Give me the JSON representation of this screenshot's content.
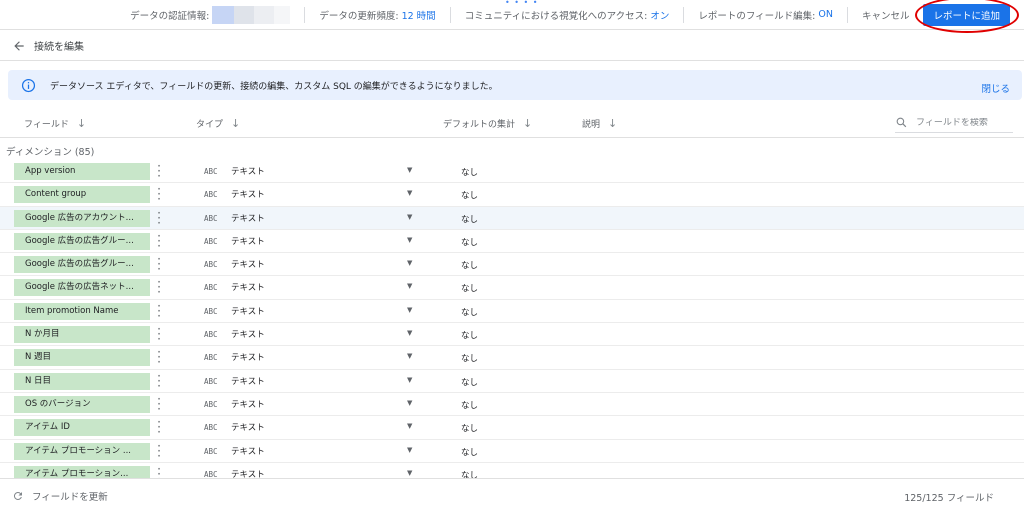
{
  "topbar": {
    "drag_handle": "• • • •",
    "credentials_label": "データの認証情報:",
    "freshness_label": "データの更新頻度:",
    "freshness_value": "12 時間",
    "community_label": "コミュニティにおける視覚化へのアクセス:",
    "community_value": "オン",
    "field_edit_label": "レポートのフィールド編集:",
    "field_edit_value": "ON",
    "cancel_label": "キャンセル",
    "add_to_report_label": "レポートに追加"
  },
  "backbar": {
    "label": "接続を編集"
  },
  "banner": {
    "message": "データソース エディタで、フィールドの更新、接続の編集、カスタム SQL の編集ができるようになりました。",
    "close_label": "閉じる"
  },
  "columns": {
    "field": "フィールド",
    "type": "タイプ",
    "default_agg": "デフォルトの集計",
    "description": "説明",
    "search_placeholder": "フィールドを検索"
  },
  "section_title": "ディメンション (85)",
  "rows": [
    {
      "name": "App version",
      "type_icon": "ABC",
      "type": "テキスト",
      "agg": "なし"
    },
    {
      "name": "Content group",
      "type_icon": "ABC",
      "type": "テキスト",
      "agg": "なし"
    },
    {
      "name": "Google 広告のアカウント...",
      "type_icon": "ABC",
      "type": "テキスト",
      "agg": "なし"
    },
    {
      "name": "Google 広告の広告グルー...",
      "type_icon": "ABC",
      "type": "テキスト",
      "agg": "なし"
    },
    {
      "name": "Google 広告の広告グルー...",
      "type_icon": "ABC",
      "type": "テキスト",
      "agg": "なし"
    },
    {
      "name": "Google 広告の広告ネット...",
      "type_icon": "ABC",
      "type": "テキスト",
      "agg": "なし"
    },
    {
      "name": "Item promotion Name",
      "type_icon": "ABC",
      "type": "テキスト",
      "agg": "なし"
    },
    {
      "name": "N か月目",
      "type_icon": "ABC",
      "type": "テキスト",
      "agg": "なし"
    },
    {
      "name": "N 週目",
      "type_icon": "ABC",
      "type": "テキスト",
      "agg": "なし"
    },
    {
      "name": "N 日目",
      "type_icon": "ABC",
      "type": "テキスト",
      "agg": "なし"
    },
    {
      "name": "OS のバージョン",
      "type_icon": "ABC",
      "type": "テキスト",
      "agg": "なし"
    },
    {
      "name": "アイテム ID",
      "type_icon": "ABC",
      "type": "テキスト",
      "agg": "なし"
    },
    {
      "name": "アイテム プロモーション ...",
      "type_icon": "ABC",
      "type": "テキスト",
      "agg": "なし"
    },
    {
      "name": "アイテム プロモーション...",
      "type_icon": "ABC",
      "type": "テキスト",
      "agg": "なし"
    }
  ],
  "footer": {
    "refresh_label": "フィールドを更新",
    "count": "125/125 フィールド"
  },
  "colors": {
    "accent": "#1a73e8",
    "chip": "#c8e6c9",
    "banner": "#e8f0fe",
    "highlight_ring": "#e00000"
  }
}
